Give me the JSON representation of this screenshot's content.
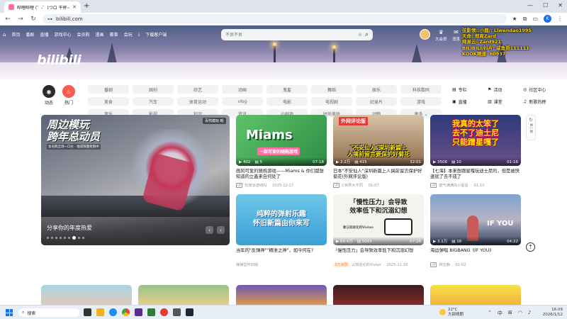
{
  "browser": {
    "tab_title": "哔哩哔哩 (゜-゜)つロ 干杯~-b...",
    "url": "bilibili.com",
    "profile_letter": "K"
  },
  "site": {
    "logo_text": "bilibili",
    "top_nav": [
      "首页",
      "番剧",
      "直播",
      "游戏中心",
      "会员购",
      "漫画",
      "赛事",
      "会玩",
      "下载客户端"
    ],
    "search_placeholder": "不良不良",
    "top_right": [
      {
        "label": "大会员",
        "icon": "crown-icon"
      },
      {
        "label": "消息",
        "icon": "message-icon",
        "badge": "99+"
      }
    ]
  },
  "overlay_lines": [
    "弦影领::小鹿/: Liwendao1995",
    "天命: 郑周Zard",
    "网易云: Zard921",
    "BILIBILI/抖片: 咸鱼哥111111",
    "KOOK频道: 60937"
  ],
  "channels": {
    "left": [
      {
        "label": "动态",
        "icon": "dynamic-icon"
      },
      {
        "label": "热门",
        "icon": "fire-icon"
      }
    ],
    "categories": [
      "番剧",
      "国创",
      "综艺",
      "动画",
      "鬼畜",
      "舞蹈",
      "娱乐",
      "科技数码",
      "美食",
      "汽车",
      "体育运动",
      "vlog",
      "电影",
      "电视剧",
      "纪录片",
      "游戏",
      "音乐",
      "影视",
      "知识",
      "资讯",
      "小剧场",
      "时尚美妆",
      "动物",
      "更多 ⌄"
    ],
    "right": [
      {
        "label": "专栏",
        "icon": "column-icon"
      },
      {
        "label": "活动",
        "icon": "activity-icon"
      },
      {
        "label": "社区中心",
        "icon": "community-icon"
      },
      {
        "label": "直播",
        "icon": "live-icon"
      },
      {
        "label": "课堂",
        "icon": "class-icon"
      },
      {
        "label": "新歌热榜",
        "icon": "music-chart-icon"
      }
    ]
  },
  "hero": {
    "title_line1": "周边模玩",
    "title_line2": "跨年总动员",
    "subline": "会员购全场一口价 · 福袋限量抢购中",
    "badge": "百鸮模玩·毗",
    "caption": "分享你的年度热爱"
  },
  "cards": [
    {
      "thumb_text": "Miams",
      "thumb_sub": "一款可爱的随购游戏",
      "views": "402",
      "danmaku": "5",
      "duration": "07:18",
      "title": "画风可爱的随购游戏——Miams & 你们都想知道的立鑫来自何处了",
      "author": "玩家派游戏吗",
      "date": "2025-12-17",
      "ad": true
    },
    {
      "thumb_text": "\"不安仙人\"深圳新篇上\n人搞前留言要保护好菊花",
      "thumb_sub": "外网评论版",
      "views": "2.2万",
      "danmaku": "415",
      "duration": "32:01",
      "title": "日本\"不安仙人\"深圳新篇上人搞前留言保护好菊花(外网评论版)",
      "author": "C世界大不同",
      "date": "01-07"
    },
    {
      "thumb_text": "我真的太笨了\n去不了迪士尼\n只能蹭星嘎了",
      "thumb_sub": "",
      "views": "3508",
      "danmaku": "10",
      "duration": "01:16",
      "title": "【七海】本来想跟星嘎玩迪士尼的，但是被快速就了去不成了",
      "author": "欧气满满的小星星",
      "date": "01-10"
    },
    {
      "thumb_text": "纯粹的弹射乐趣\n怀旧新篇由你来写",
      "thumb_sub": "",
      "views": "",
      "danmaku": "",
      "duration": "",
      "title": "当年的\"反弹神\"\"精准之神\"，如今何在?",
      "author": "弹弹堂怀旧版",
      "date": "",
      "ad": true
    },
    {
      "thumb_text": "「慢性压力」会导致\n效率低下和沉溺幻想",
      "thumb_sub": "象认知进化的Vivian",
      "views": "60.4万",
      "danmaku": "5003",
      "duration": "07:26",
      "title": "「慢性压力」会导致效率低下和沉溺幻想",
      "author": "认知进化的Vivian",
      "date": "2025-11-16",
      "hot": "3万点赞"
    },
    {
      "thumb_text": "IF YOU",
      "thumb_sub": "",
      "views": "3.1万",
      "danmaku": "18",
      "duration": "04:22",
      "title": "海边弹唱 BIGBANG《IF YOU》",
      "author": "林宝静",
      "date": "01-02"
    }
  ],
  "float_panel": {
    "refresh_label": "换一换",
    "top_label": "顶部"
  },
  "taskbar": {
    "search_placeholder": "搜索",
    "weather_temp": "22°C",
    "weather_desc": "大部晴朗",
    "ime": "中",
    "time": "16:09",
    "date": "2026/1/12"
  },
  "colors": {
    "brand": "#fb7299",
    "accent": "#00aeec",
    "text": "#18191c",
    "muted": "#9499a0"
  }
}
